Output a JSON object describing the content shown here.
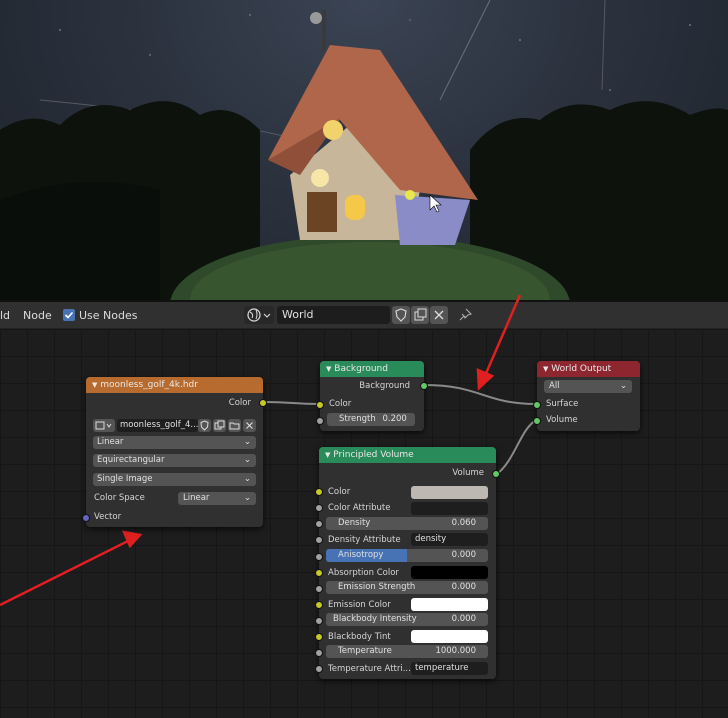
{
  "header": {
    "menu_partial": "ld",
    "node_menu": "Node",
    "use_nodes_label": "Use Nodes",
    "world_name": "World"
  },
  "nodes": {
    "image_texture": {
      "title": "moonless_golf_4k.hdr",
      "color_output": "Color",
      "image_name": "moonless_golf_4...",
      "interpolation": "Linear",
      "projection": "Equirectangular",
      "source": "Single Image",
      "color_space_label": "Color Space",
      "color_space_value": "Linear",
      "vector_input": "Vector"
    },
    "background": {
      "title": "Background",
      "output": "Background",
      "color_input": "Color",
      "strength_label": "Strength",
      "strength_value": "0.200"
    },
    "world_output": {
      "title": "World Output",
      "target": "All",
      "surface_input": "Surface",
      "volume_input": "Volume"
    },
    "principled_volume": {
      "title": "Principled Volume",
      "output": "Volume",
      "color_label": "Color",
      "color_attr_label": "Color Attribute",
      "density_label": "Density",
      "density_value": "0.060",
      "density_attr_label": "Density Attribute",
      "density_attr_value": "density",
      "anisotropy_label": "Anisotropy",
      "anisotropy_value": "0.000",
      "absorption_label": "Absorption Color",
      "emission_strength_label": "Emission Strength",
      "emission_strength_value": "0.000",
      "emission_color_label": "Emission Color",
      "blackbody_intensity_label": "Blackbody Intensity",
      "blackbody_intensity_value": "0.000",
      "blackbody_tint_label": "Blackbody Tint",
      "temperature_label": "Temperature",
      "temperature_value": "1000.000",
      "temperature_attr_label": "Temperature Attri...",
      "temperature_attr_value": "temperature"
    }
  },
  "colors": {
    "texture_header": "#b86b2e",
    "shader_header": "#2a8b5a",
    "output_header": "#8e2630",
    "annotation_arrow": "#e02020",
    "socket_color": "#c7c729",
    "socket_shader": "#63c763"
  }
}
